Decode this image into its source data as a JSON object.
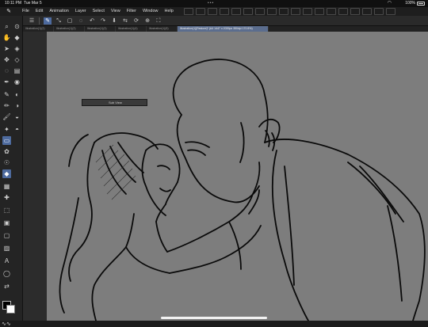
{
  "status": {
    "time": "10:11 PM",
    "date": "Tue Mar 5",
    "battery": "100%",
    "dots": "•••"
  },
  "menubar": {
    "logo_icon": "brush-logo-icon",
    "items": [
      "File",
      "Edit",
      "Animation",
      "Layer",
      "Select",
      "View",
      "Filter",
      "Window",
      "Help"
    ]
  },
  "tabs": [
    {
      "label": "Illustration(1)(2)",
      "active": false
    },
    {
      "label": "Illustration(1)(2)",
      "active": false
    },
    {
      "label": "Illustration(1)(3)",
      "active": false
    },
    {
      "label": "Illustration(1)(4)",
      "active": false
    },
    {
      "label": "Illustration(1)(5)",
      "active": false
    },
    {
      "label": "Illustration(1)[Restore]* (A4 1447 x 2039px 350dpi 170.5%)",
      "active": true
    }
  ],
  "subview": {
    "label": "Sub View"
  },
  "colors": {
    "canvas": "#7d7d7d",
    "accent": "#4d6a9e",
    "main_color": "#000000",
    "sub_color": "#ffffff"
  }
}
